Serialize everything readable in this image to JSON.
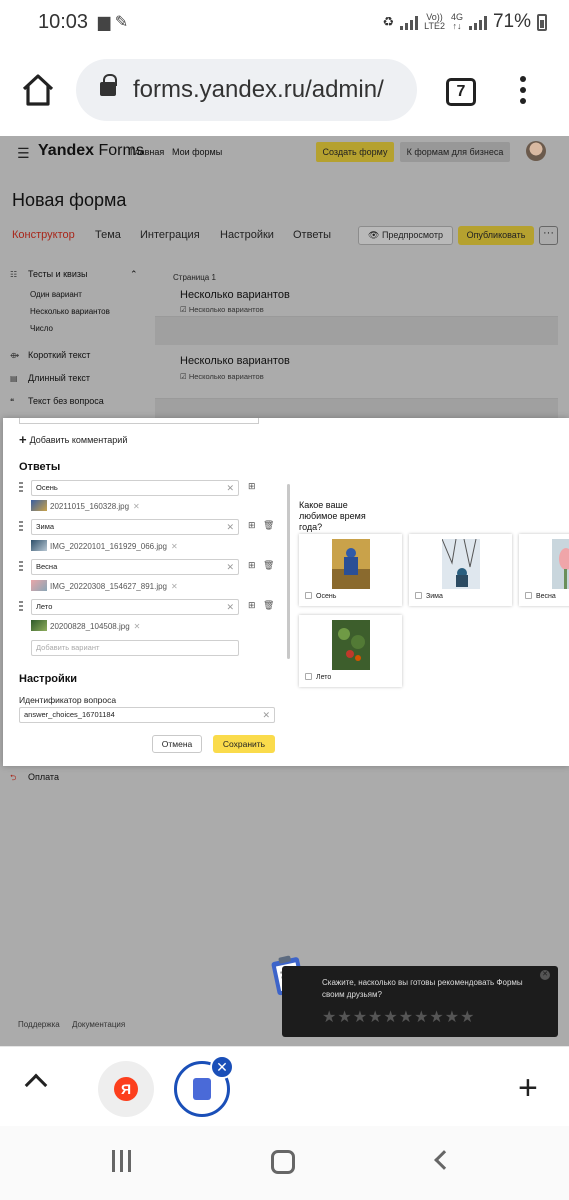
{
  "status": {
    "time": "10:03",
    "carrier_top": "Vo))",
    "carrier_bottom": "LTE2",
    "net": "4G",
    "battery": "71%"
  },
  "browser": {
    "url": "forms.yandex.ru/admin/",
    "tab_count": "7"
  },
  "header": {
    "brand": "Yandex",
    "product": "Forms",
    "nav_home": "Главная",
    "nav_myforms": "Мои формы",
    "create_button": "Создать форму",
    "business_button": "К формам для бизнеса"
  },
  "form": {
    "title": "Новая форма",
    "tabs": [
      "Конструктор",
      "Тема",
      "Интеграция",
      "Настройки",
      "Ответы"
    ],
    "preview_button": "Предпросмотр",
    "publish_button": "Опубликовать",
    "more_button": "···"
  },
  "sidebar": {
    "group": "Тесты и квизы",
    "subitems": [
      "Один вариант",
      "Несколько вариантов",
      "Число"
    ],
    "items": [
      "Короткий текст",
      "Длинный текст",
      "Текст без вопроса"
    ],
    "payment": "Оплата"
  },
  "canvas": {
    "page_label": "Страница 1",
    "questions": [
      {
        "title": "Несколько вариантов",
        "sub": "Несколько вариантов"
      },
      {
        "title": "Несколько вариантов",
        "sub": "Несколько вариантов"
      }
    ]
  },
  "editor": {
    "add_comment": "Добавить комментарий",
    "answers_title": "Ответы",
    "answers": [
      {
        "value": "Осень",
        "file": "20211015_160328.jpg"
      },
      {
        "value": "Зима",
        "file": "IMG_20220101_161929_066.jpg"
      },
      {
        "value": "Весна",
        "file": "IMG_20220308_154627_891.jpg"
      },
      {
        "value": "Лето",
        "file": "20200828_104508.jpg"
      }
    ],
    "add_variant_placeholder": "Добавить вариант",
    "settings_title": "Настройки",
    "id_label": "Идентификатор вопроса",
    "id_value": "answer_choices_16701184",
    "cancel": "Отмена",
    "save": "Сохранить"
  },
  "preview": {
    "question": "Какое ваше любимое время года?",
    "options": [
      "Осень",
      "Зима",
      "Весна",
      "Лето"
    ]
  },
  "footer": {
    "support": "Поддержка",
    "docs": "Документация"
  },
  "toast": {
    "text": "Скажите, насколько вы готовы рекомендовать Формы своим друзьям?",
    "stars": "★★★★★★★★★★"
  },
  "toolbar": {
    "yandex_letter": "Я",
    "badge": "✕"
  },
  "colors": {
    "accent_yellow": "#fadb4b",
    "active_tab_red": "#a8261a",
    "tab_blue": "#1a4fb8"
  }
}
